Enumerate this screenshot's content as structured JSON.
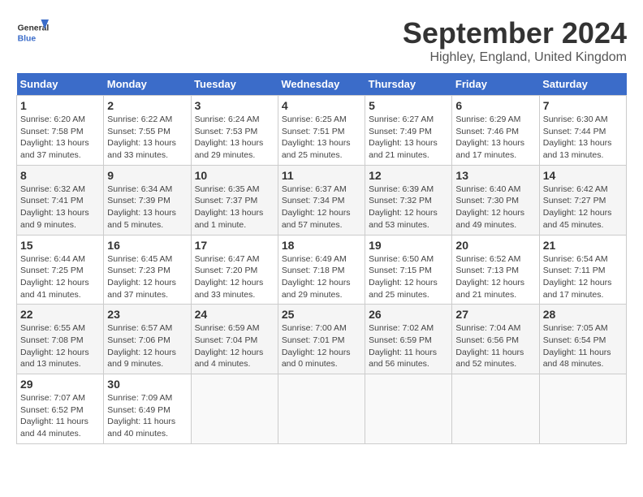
{
  "header": {
    "logo_line1": "General",
    "logo_line2": "Blue",
    "month_title": "September 2024",
    "location": "Highley, England, United Kingdom"
  },
  "days_of_week": [
    "Sunday",
    "Monday",
    "Tuesday",
    "Wednesday",
    "Thursday",
    "Friday",
    "Saturday"
  ],
  "weeks": [
    [
      {
        "day": "1",
        "info": "Sunrise: 6:20 AM\nSunset: 7:58 PM\nDaylight: 13 hours\nand 37 minutes."
      },
      {
        "day": "2",
        "info": "Sunrise: 6:22 AM\nSunset: 7:55 PM\nDaylight: 13 hours\nand 33 minutes."
      },
      {
        "day": "3",
        "info": "Sunrise: 6:24 AM\nSunset: 7:53 PM\nDaylight: 13 hours\nand 29 minutes."
      },
      {
        "day": "4",
        "info": "Sunrise: 6:25 AM\nSunset: 7:51 PM\nDaylight: 13 hours\nand 25 minutes."
      },
      {
        "day": "5",
        "info": "Sunrise: 6:27 AM\nSunset: 7:49 PM\nDaylight: 13 hours\nand 21 minutes."
      },
      {
        "day": "6",
        "info": "Sunrise: 6:29 AM\nSunset: 7:46 PM\nDaylight: 13 hours\nand 17 minutes."
      },
      {
        "day": "7",
        "info": "Sunrise: 6:30 AM\nSunset: 7:44 PM\nDaylight: 13 hours\nand 13 minutes."
      }
    ],
    [
      {
        "day": "8",
        "info": "Sunrise: 6:32 AM\nSunset: 7:41 PM\nDaylight: 13 hours\nand 9 minutes."
      },
      {
        "day": "9",
        "info": "Sunrise: 6:34 AM\nSunset: 7:39 PM\nDaylight: 13 hours\nand 5 minutes."
      },
      {
        "day": "10",
        "info": "Sunrise: 6:35 AM\nSunset: 7:37 PM\nDaylight: 13 hours\nand 1 minute."
      },
      {
        "day": "11",
        "info": "Sunrise: 6:37 AM\nSunset: 7:34 PM\nDaylight: 12 hours\nand 57 minutes."
      },
      {
        "day": "12",
        "info": "Sunrise: 6:39 AM\nSunset: 7:32 PM\nDaylight: 12 hours\nand 53 minutes."
      },
      {
        "day": "13",
        "info": "Sunrise: 6:40 AM\nSunset: 7:30 PM\nDaylight: 12 hours\nand 49 minutes."
      },
      {
        "day": "14",
        "info": "Sunrise: 6:42 AM\nSunset: 7:27 PM\nDaylight: 12 hours\nand 45 minutes."
      }
    ],
    [
      {
        "day": "15",
        "info": "Sunrise: 6:44 AM\nSunset: 7:25 PM\nDaylight: 12 hours\nand 41 minutes."
      },
      {
        "day": "16",
        "info": "Sunrise: 6:45 AM\nSunset: 7:23 PM\nDaylight: 12 hours\nand 37 minutes."
      },
      {
        "day": "17",
        "info": "Sunrise: 6:47 AM\nSunset: 7:20 PM\nDaylight: 12 hours\nand 33 minutes."
      },
      {
        "day": "18",
        "info": "Sunrise: 6:49 AM\nSunset: 7:18 PM\nDaylight: 12 hours\nand 29 minutes."
      },
      {
        "day": "19",
        "info": "Sunrise: 6:50 AM\nSunset: 7:15 PM\nDaylight: 12 hours\nand 25 minutes."
      },
      {
        "day": "20",
        "info": "Sunrise: 6:52 AM\nSunset: 7:13 PM\nDaylight: 12 hours\nand 21 minutes."
      },
      {
        "day": "21",
        "info": "Sunrise: 6:54 AM\nSunset: 7:11 PM\nDaylight: 12 hours\nand 17 minutes."
      }
    ],
    [
      {
        "day": "22",
        "info": "Sunrise: 6:55 AM\nSunset: 7:08 PM\nDaylight: 12 hours\nand 13 minutes."
      },
      {
        "day": "23",
        "info": "Sunrise: 6:57 AM\nSunset: 7:06 PM\nDaylight: 12 hours\nand 9 minutes."
      },
      {
        "day": "24",
        "info": "Sunrise: 6:59 AM\nSunset: 7:04 PM\nDaylight: 12 hours\nand 4 minutes."
      },
      {
        "day": "25",
        "info": "Sunrise: 7:00 AM\nSunset: 7:01 PM\nDaylight: 12 hours\nand 0 minutes."
      },
      {
        "day": "26",
        "info": "Sunrise: 7:02 AM\nSunset: 6:59 PM\nDaylight: 11 hours\nand 56 minutes."
      },
      {
        "day": "27",
        "info": "Sunrise: 7:04 AM\nSunset: 6:56 PM\nDaylight: 11 hours\nand 52 minutes."
      },
      {
        "day": "28",
        "info": "Sunrise: 7:05 AM\nSunset: 6:54 PM\nDaylight: 11 hours\nand 48 minutes."
      }
    ],
    [
      {
        "day": "29",
        "info": "Sunrise: 7:07 AM\nSunset: 6:52 PM\nDaylight: 11 hours\nand 44 minutes."
      },
      {
        "day": "30",
        "info": "Sunrise: 7:09 AM\nSunset: 6:49 PM\nDaylight: 11 hours\nand 40 minutes."
      },
      null,
      null,
      null,
      null,
      null
    ]
  ]
}
